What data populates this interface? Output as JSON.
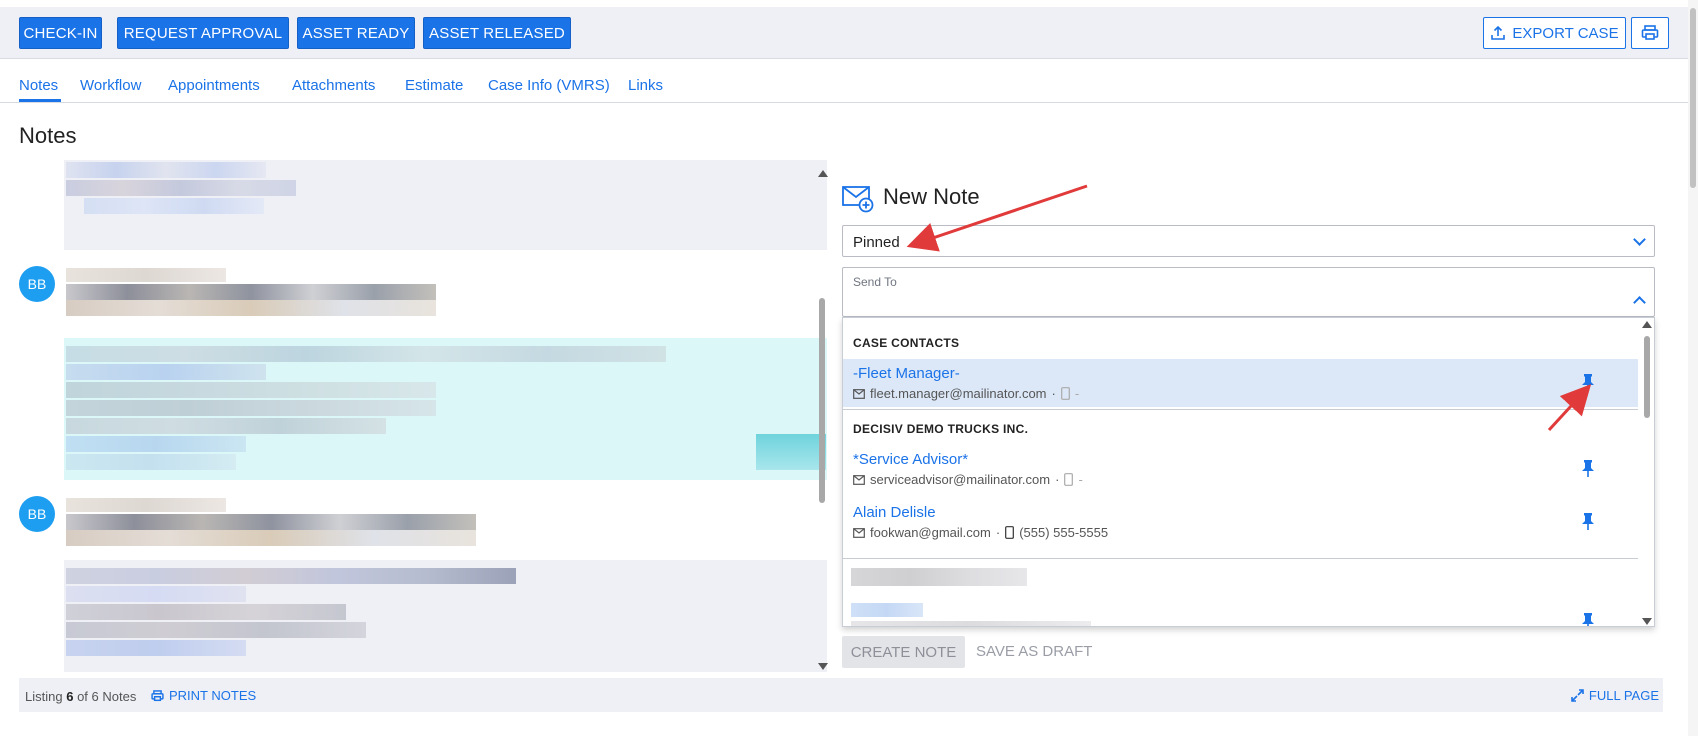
{
  "toolbar": {
    "check_in": "CHECK-IN",
    "request_approval": "REQUEST APPROVAL",
    "asset_ready": "ASSET READY",
    "asset_released": "ASSET RELEASED",
    "export_case": "EXPORT CASE"
  },
  "tabs": [
    {
      "label": "Notes"
    },
    {
      "label": "Workflow"
    },
    {
      "label": "Appointments"
    },
    {
      "label": "Attachments"
    },
    {
      "label": "Estimate"
    },
    {
      "label": "Case Info (VMRS)"
    },
    {
      "label": "Links"
    }
  ],
  "page_title": "Notes",
  "notes": {
    "avatars": [
      "BB",
      "BB"
    ]
  },
  "new_note": {
    "title": "New Note",
    "visibility_value": "Pinned",
    "send_to_label": "Send To",
    "groups": [
      {
        "header": "CASE CONTACTS"
      },
      {
        "header": "DECISIV DEMO TRUCKS INC."
      }
    ],
    "contacts": [
      {
        "name": "-Fleet Manager-",
        "email": "fleet.manager@mailinator.com",
        "phone": "-"
      },
      {
        "name": "*Service Advisor*",
        "email": "serviceadvisor@mailinator.com",
        "phone": "-"
      },
      {
        "name": "Alain Delisle",
        "email": "fookwan@gmail.com",
        "phone": "(555) 555-5555"
      }
    ],
    "create_button": "CREATE NOTE",
    "save_draft_button": "SAVE AS DRAFT"
  },
  "footer": {
    "listing_prefix": "Listing",
    "listing_count": "6",
    "listing_suffix": "of 6 Notes",
    "print_notes": "PRINT NOTES",
    "full_page": "FULL PAGE"
  },
  "colors": {
    "primary": "#1b73e8",
    "avatar": "#1e9ef0",
    "highlight_row": "#dce8f8",
    "annotation_arrow": "#e03a3a"
  }
}
